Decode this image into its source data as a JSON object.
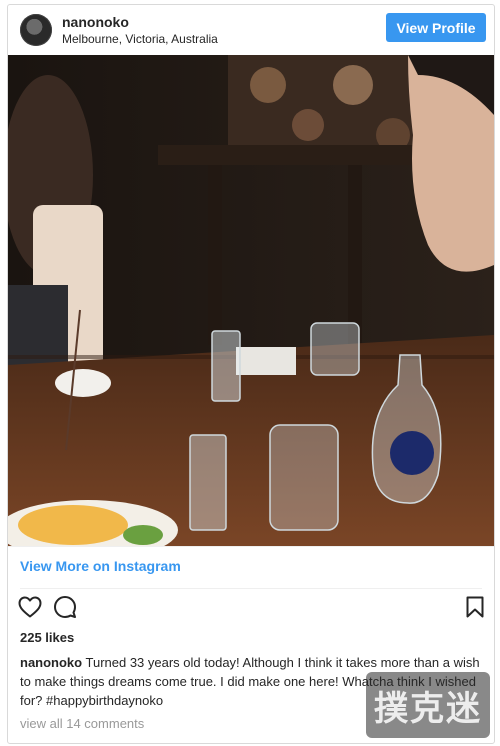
{
  "header": {
    "username": "nanonoko",
    "location": "Melbourne, Victoria, Australia",
    "view_profile_label": "View Profile"
  },
  "links": {
    "view_more": "View More on Instagram"
  },
  "actions": {
    "icons": [
      "heart-icon",
      "comment-icon",
      "bookmark-icon"
    ]
  },
  "post": {
    "likes": "225 likes",
    "caption_user": "nanonoko",
    "caption_text": "Turned 33 years old today! Although I think it takes more than a wish to make things dreams come true. I did make one here! Whatcha think I wished for?",
    "hashtag": "#happybirthdaynoko",
    "view_comments": "view all 14 comments"
  },
  "watermark": {
    "text": "撲克迷"
  },
  "colors": {
    "accent": "#3897f0",
    "text": "#262626",
    "muted": "#999999"
  }
}
